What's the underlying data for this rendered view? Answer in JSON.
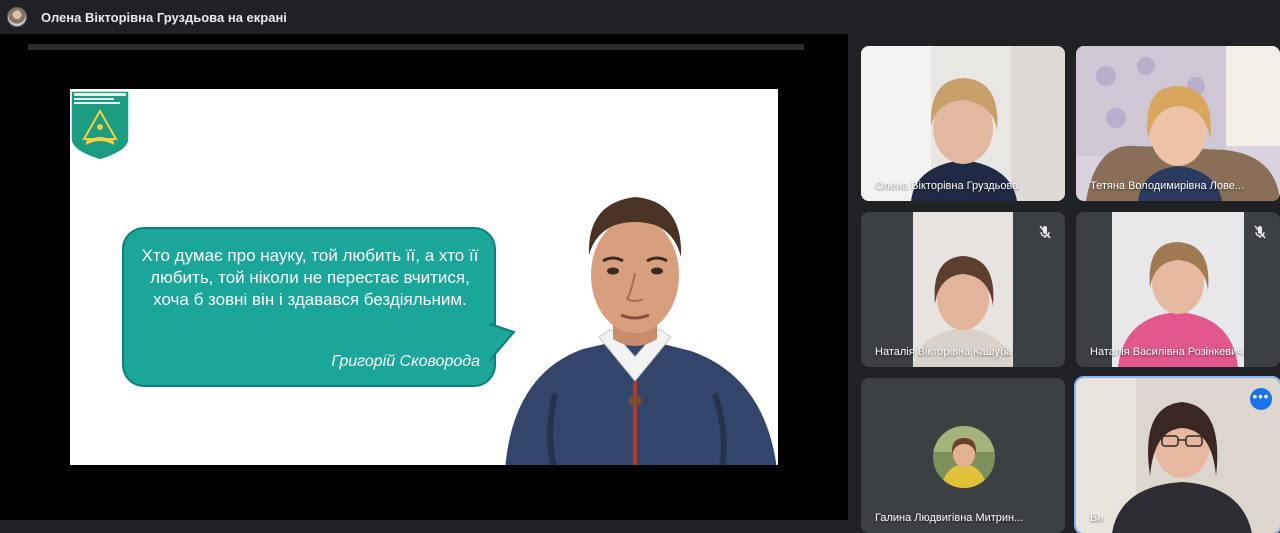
{
  "topbar": {
    "presenter_label": "Олена Вікторівна Груздьова на екрані"
  },
  "slide": {
    "logo_text": "Київський університет імені Бориса Грінченка",
    "quote": "Хто думає про науку, той любить її, а хто її любить, той ніколи не перестає вчитися, хоча б зовні він і здавався бездіяльним.",
    "author": "Григорій Сковорода"
  },
  "participants": [
    {
      "name": "Олена Вікторівна Груздьова",
      "muted": false
    },
    {
      "name": "Тетяна Володимирівна Лове...",
      "muted": false
    },
    {
      "name": "Наталія Вікторівна Кашуба",
      "muted": true
    },
    {
      "name": "Наталія Василівна Розінкевич",
      "muted": true
    },
    {
      "name": "Галина Людвигівна Митрин...",
      "muted": false
    },
    {
      "name": "Ви",
      "muted": false
    }
  ],
  "colors": {
    "bubble": "#1aa79a",
    "accent": "#1a73e8",
    "background": "#202124",
    "tile": "#3c4043"
  },
  "icons": {
    "mic_off": "mic-off-icon",
    "more_options": "more-options-icon"
  }
}
